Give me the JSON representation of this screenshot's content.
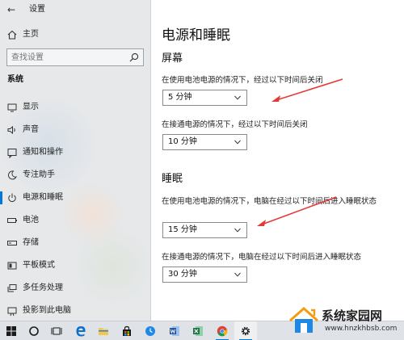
{
  "window": {
    "app_title": "设置"
  },
  "sidebar": {
    "home_label": "主页",
    "search_placeholder": "查找设置",
    "section_title": "系统",
    "items": [
      {
        "label": "显示",
        "icon": "monitor-icon",
        "active": false
      },
      {
        "label": "声音",
        "icon": "speaker-icon",
        "active": false
      },
      {
        "label": "通知和操作",
        "icon": "notification-icon",
        "active": false
      },
      {
        "label": "专注助手",
        "icon": "moon-icon",
        "active": false
      },
      {
        "label": "电源和睡眠",
        "icon": "power-icon",
        "active": true
      },
      {
        "label": "电池",
        "icon": "battery-icon",
        "active": false
      },
      {
        "label": "存储",
        "icon": "storage-icon",
        "active": false
      },
      {
        "label": "平板模式",
        "icon": "tablet-icon",
        "active": false
      },
      {
        "label": "多任务处理",
        "icon": "multitask-icon",
        "active": false
      },
      {
        "label": "投影到此电脑",
        "icon": "project-icon",
        "active": false
      }
    ]
  },
  "main": {
    "page_title": "电源和睡眠",
    "screen": {
      "title": "屏幕",
      "battery_label": "在使用电池电源的情况下，经过以下时间后关闭",
      "battery_value": "5 分钟",
      "plugged_label": "在接通电源的情况下，经过以下时间后关闭",
      "plugged_value": "10 分钟"
    },
    "sleep": {
      "title": "睡眠",
      "battery_label": "在使用电池电源的情况下，电脑在经过以下时间后进入睡眠状态",
      "battery_value": "15 分钟",
      "plugged_label": "在接通电源的情况下，电脑在经过以下时间后进入睡眠状态",
      "plugged_value": "30 分钟"
    }
  },
  "taskbar": {
    "icons": [
      "windows-start-icon",
      "cortana-icon",
      "task-view-icon",
      "edge-icon",
      "file-explorer-icon",
      "store-icon",
      "clock-app-icon",
      "word-icon",
      "excel-icon",
      "chrome-icon",
      "settings-gear-icon"
    ]
  },
  "watermark": {
    "title": "系统家园网",
    "url": "www.hnzkhbsb.com"
  },
  "colors": {
    "accent": "#0078d7",
    "annotation_arrow": "#e53935",
    "sidebar_bg": "#e6e8ea",
    "taskbar_bg": "#dfe2e6"
  }
}
